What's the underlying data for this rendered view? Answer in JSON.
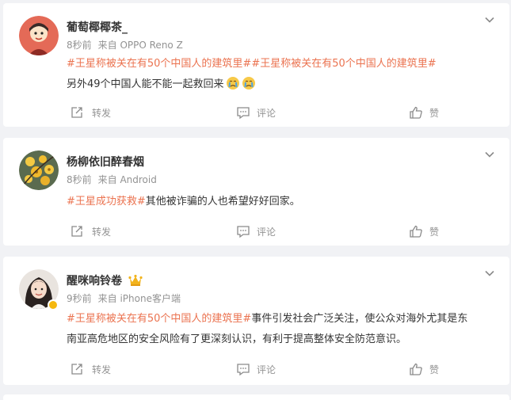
{
  "posts": [
    {
      "username": "葡萄椰椰茶_",
      "time": "8秒前",
      "source": "来自 OPPO Reno Z",
      "hashtags": [
        "#王星称被关在有50个中国人的建筑里#",
        "#王星称被关在有50个中国人的建筑里#"
      ],
      "text": "另外49个中国人能不能一起救回来",
      "emoji": [
        "crying-face-emoji",
        "crying-face-emoji"
      ],
      "actions": {
        "repost": "转发",
        "comment": "评论",
        "like": "赞"
      }
    },
    {
      "username": "杨柳依旧醉春烟",
      "time": "8秒前",
      "source": "来自 Android",
      "hashtags": [
        "#王星成功获救#"
      ],
      "text": "其他被诈骗的人也希望好好回家。",
      "actions": {
        "repost": "转发",
        "comment": "评论",
        "like": "赞"
      }
    },
    {
      "username": "醒咪响铃卷",
      "time": "9秒前",
      "source": "来自 iPhone客户端",
      "hashtags": [
        "#王星称被关在有50个中国人的建筑里#"
      ],
      "text_line1": "事件引发社会广泛关注，使公众对海外尤其是东",
      "text_line2": "南亚高危地区的安全风险有了更深刻认识，有利于提高整体安全防范意识。",
      "actions": {
        "repost": "转发",
        "comment": "评论",
        "like": "赞"
      }
    }
  ],
  "colors": {
    "hashtag": "#eb7350",
    "username": "#333333",
    "meta": "#939393",
    "background": "#f1f2f5"
  }
}
